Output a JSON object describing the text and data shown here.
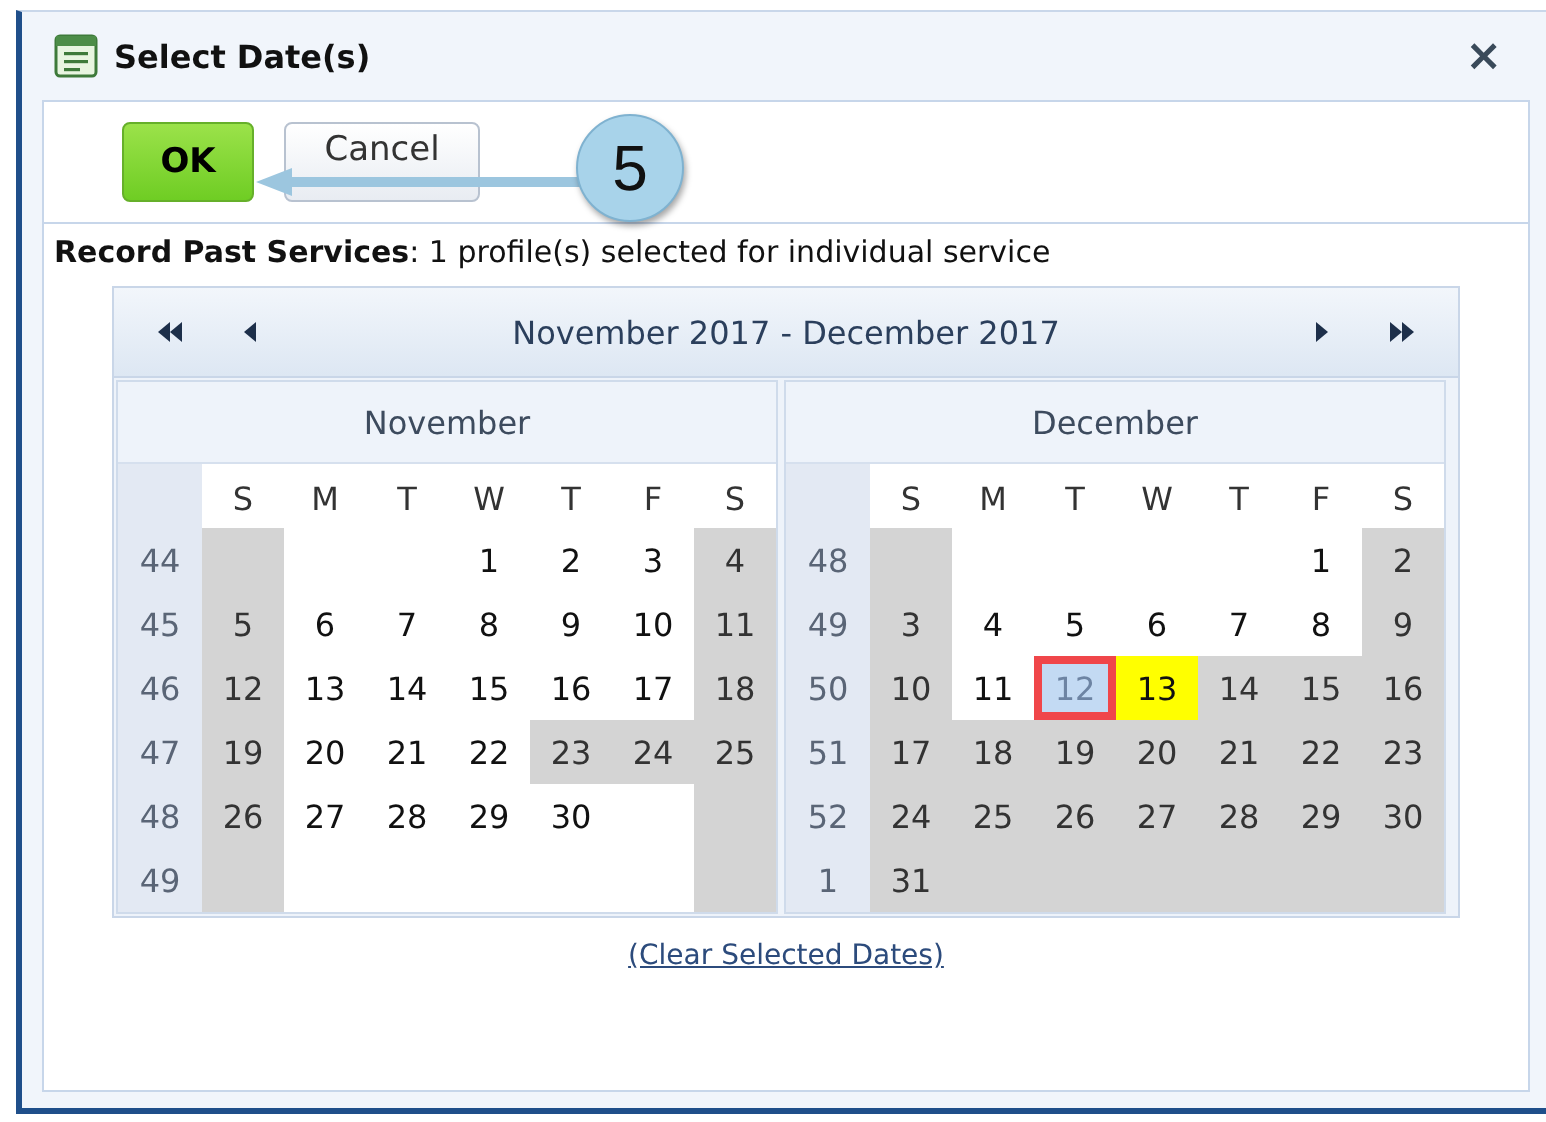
{
  "window": {
    "title": "Select Date(s)",
    "close": "×"
  },
  "toolbar": {
    "buttons": [
      {
        "label": "OK",
        "kind": "primary"
      },
      {
        "label": "Cancel",
        "kind": "secondary"
      }
    ]
  },
  "callout": {
    "number": "5"
  },
  "info": "**Record Past Services**:  1 profile(s) selected for individual service",
  "calendar": {
    "range_title": "November 2017 - December 2017",
    "months": [
      {
        "name": "November",
        "day_names": [
          "S",
          "M",
          "T",
          "W",
          "T",
          "F",
          "S"
        ],
        "weeks": [
          {
            "week": "44",
            "days": [
              {
                "disabled": true
              },
              {
                "disabled": false
              },
              {
                "disabled": false
              },
              {
                "day": "1",
                "disabled": false
              },
              {
                "day": "2",
                "disabled": false
              },
              {
                "day": "3",
                "disabled": false
              },
              {
                "day": "4",
                "disabled": true
              }
            ]
          },
          {
            "week": "45",
            "days": [
              {
                "day": "5",
                "disabled": true
              },
              {
                "day": "6",
                "disabled": false
              },
              {
                "day": "7",
                "disabled": false
              },
              {
                "day": "8",
                "disabled": false
              },
              {
                "day": "9",
                "disabled": false
              },
              {
                "day": "10",
                "disabled": false
              },
              {
                "day": "11",
                "disabled": true
              }
            ]
          },
          {
            "week": "46",
            "days": [
              {
                "day": "12",
                "disabled": true
              },
              {
                "day": "13",
                "disabled": false
              },
              {
                "day": "14",
                "disabled": false
              },
              {
                "day": "15",
                "disabled": false
              },
              {
                "day": "16",
                "disabled": false
              },
              {
                "day": "17",
                "disabled": false
              },
              {
                "day": "18",
                "disabled": true
              }
            ]
          },
          {
            "week": "47",
            "days": [
              {
                "day": "19",
                "disabled": true
              },
              {
                "day": "20",
                "disabled": false
              },
              {
                "day": "21",
                "disabled": false
              },
              {
                "day": "22",
                "disabled": false
              },
              {
                "day": "23",
                "disabled": true
              },
              {
                "day": "24",
                "disabled": true
              },
              {
                "day": "25",
                "disabled": true
              }
            ]
          },
          {
            "week": "48",
            "days": [
              {
                "day": "26",
                "disabled": true
              },
              {
                "day": "27",
                "disabled": false
              },
              {
                "day": "28",
                "disabled": false
              },
              {
                "day": "29",
                "disabled": false
              },
              {
                "day": "30",
                "disabled": false
              },
              {
                "disabled": false
              },
              {
                "disabled": true
              }
            ]
          },
          {
            "week": "49",
            "days": [
              {
                "disabled": true
              },
              {
                "disabled": false
              },
              {
                "disabled": false
              },
              {
                "disabled": false
              },
              {
                "disabled": false
              },
              {
                "disabled": false
              },
              {
                "disabled": true
              }
            ]
          }
        ]
      },
      {
        "name": "December",
        "day_names": [
          "S",
          "M",
          "T",
          "W",
          "T",
          "F",
          "S"
        ],
        "weeks": [
          {
            "week": "48",
            "days": [
              {
                "disabled": true
              },
              {
                "disabled": false
              },
              {
                "disabled": false
              },
              {
                "disabled": false
              },
              {
                "disabled": false
              },
              {
                "day": "1",
                "disabled": false
              },
              {
                "day": "2",
                "disabled": true
              }
            ]
          },
          {
            "week": "49",
            "days": [
              {
                "day": "3",
                "disabled": true
              },
              {
                "day": "4",
                "disabled": false
              },
              {
                "day": "5",
                "disabled": false
              },
              {
                "day": "6",
                "disabled": false
              },
              {
                "day": "7",
                "disabled": false
              },
              {
                "day": "8",
                "disabled": false
              },
              {
                "day": "9",
                "disabled": true
              }
            ]
          },
          {
            "week": "50",
            "days": [
              {
                "day": "10",
                "disabled": true
              },
              {
                "day": "11",
                "disabled": false
              },
              {
                "day": "12",
                "disabled": false,
                "selected": true
              },
              {
                "day": "13",
                "disabled": false,
                "highlighted": true
              },
              {
                "day": "14",
                "disabled": true
              },
              {
                "day": "15",
                "disabled": true
              },
              {
                "day": "16",
                "disabled": true
              }
            ]
          },
          {
            "week": "51",
            "days": [
              {
                "day": "17",
                "disabled": true
              },
              {
                "day": "18",
                "disabled": true
              },
              {
                "day": "19",
                "disabled": true
              },
              {
                "day": "20",
                "disabled": true
              },
              {
                "day": "21",
                "disabled": true
              },
              {
                "day": "22",
                "disabled": true
              },
              {
                "day": "23",
                "disabled": true
              }
            ]
          },
          {
            "week": "52",
            "days": [
              {
                "day": "24",
                "disabled": true
              },
              {
                "day": "25",
                "disabled": true
              },
              {
                "day": "26",
                "disabled": true
              },
              {
                "day": "27",
                "disabled": true
              },
              {
                "day": "28",
                "disabled": true
              },
              {
                "day": "29",
                "disabled": true
              },
              {
                "day": "30",
                "disabled": true
              }
            ]
          },
          {
            "week": "1",
            "days": [
              {
                "day": "31",
                "disabled": true
              },
              {
                "disabled": true
              },
              {
                "disabled": true
              },
              {
                "disabled": true
              },
              {
                "disabled": true
              },
              {
                "disabled": true
              },
              {
                "disabled": true
              }
            ]
          }
        ]
      }
    ]
  },
  "clear_link": "(Clear Selected Dates)"
}
